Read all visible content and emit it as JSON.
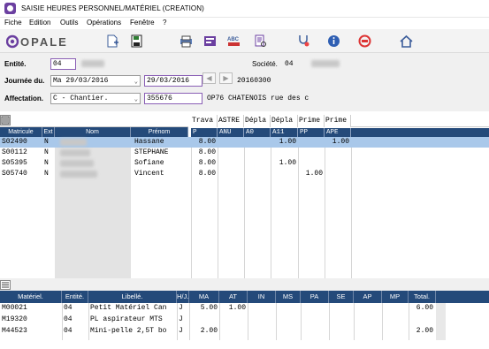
{
  "window": {
    "title": "SAISIE HEURES PERSONNEL/MATÉRIEL  (CREATION)"
  },
  "menu": [
    "Fiche",
    "Edition",
    "Outils",
    "Opérations",
    "Fenêtre",
    "?"
  ],
  "logo_text": "OPALE",
  "toolbar_icons": [
    "new-document-icon",
    "save-icon",
    "print-icon",
    "card-list-icon",
    "abc-text-icon",
    "document-search-icon",
    "stethoscope-icon",
    "info-icon",
    "exit-icon",
    "home-icon"
  ],
  "header": {
    "entite_label": "Entité.",
    "entite_value": "04",
    "societe_label": "Société.",
    "societe_value": "04",
    "journee_label": "Journée du.",
    "journee_value": "Ma 29/03/2016",
    "journee_date": "29/03/2016",
    "journee_code": "20160300",
    "affectation_label": "Affectation.",
    "affectation_value": "C - Chantier.",
    "affectation_code": "355676",
    "affectation_desc": "OP76 CHATENOIS rue des c"
  },
  "personnel": {
    "headers": [
      "Matricule",
      "Ext",
      "Nom",
      "Prénom"
    ],
    "col_labels": [
      "Trava",
      "ASTRE",
      "Dépla",
      "Dépla",
      "Prime",
      "Prime"
    ],
    "col_codes": [
      "P",
      "ANU",
      "A0",
      "A11",
      "PP",
      "APE"
    ],
    "rows": [
      {
        "matricule": "S02490",
        "ext": "N",
        "prenom": "Hassane",
        "vals": [
          "8.00",
          "",
          "",
          "1.00",
          "",
          "1.00"
        ]
      },
      {
        "matricule": "S00112",
        "ext": "N",
        "prenom": "STEPHANE",
        "vals": [
          "8.00",
          "",
          "",
          "",
          "",
          ""
        ]
      },
      {
        "matricule": "S05395",
        "ext": "N",
        "prenom": "Sofiane",
        "vals": [
          "8.00",
          "",
          "",
          "1.00",
          "",
          ""
        ]
      },
      {
        "matricule": "S05740",
        "ext": "N",
        "prenom": "Vincent",
        "vals": [
          "8.00",
          "",
          "",
          "",
          "1.00",
          ""
        ]
      }
    ]
  },
  "materiel": {
    "headers": [
      "Matériel.",
      "Entité.",
      "Libellé.",
      "H/J.",
      "MA",
      "AT",
      "IN",
      "MS",
      "PA",
      "SE",
      "AP",
      "MP",
      "Total."
    ],
    "rows": [
      {
        "materiel": "M00021",
        "entite": "04",
        "libelle": "Petit Matériel Can",
        "hj": "J",
        "ma": "5.00",
        "at": "1.00",
        "total": "6.00"
      },
      {
        "materiel": "M19320",
        "entite": "04",
        "libelle": "PL aspirateur MTS",
        "hj": "J",
        "ma": "",
        "at": "",
        "total": ""
      },
      {
        "materiel": "M44523",
        "entite": "04",
        "libelle": "Mini-pelle 2,5T bo",
        "hj": "J",
        "ma": "2.00",
        "at": "",
        "total": "2.00"
      }
    ]
  },
  "colors": {
    "header_blue": "#244a7a",
    "selected_row": "#a9c8ea",
    "accent_purple": "#6b3fa0"
  }
}
